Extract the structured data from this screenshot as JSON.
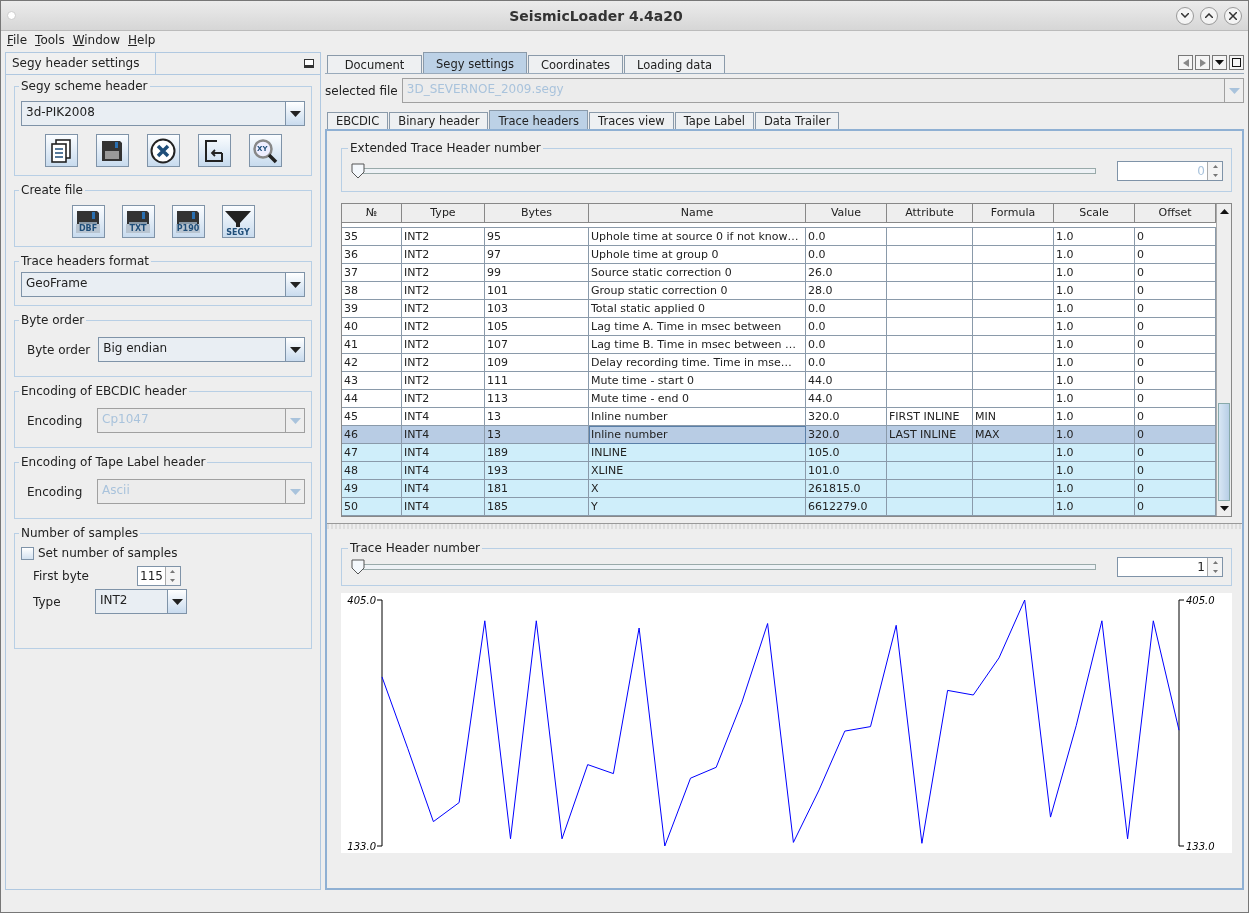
{
  "window": {
    "title": "SeismicLoader 4.4a20"
  },
  "menu": [
    {
      "label": "File"
    },
    {
      "label": "Tools"
    },
    {
      "label": "Window"
    },
    {
      "label": "Help"
    }
  ],
  "left_panel": {
    "title": "Segy header settings",
    "scheme": {
      "legend": "Segy scheme header",
      "value": "3d-PIK2008",
      "buttons": [
        {
          "kind": "copy"
        },
        {
          "kind": "save"
        },
        {
          "kind": "delete"
        },
        {
          "kind": "import"
        },
        {
          "kind": "xy-search",
          "icon_text": "XY"
        }
      ]
    },
    "create_file": {
      "legend": "Create file",
      "buttons": [
        {
          "kind": "floppy",
          "icon_text": "DBF"
        },
        {
          "kind": "floppy",
          "icon_text": "TXT"
        },
        {
          "kind": "floppy",
          "icon_text": "P190"
        },
        {
          "kind": "funnel",
          "icon_text": "SEGY"
        }
      ]
    },
    "trace_format": {
      "legend": "Trace headers format",
      "value": "GeoFrame",
      "disabled": false
    },
    "byte_order": {
      "legend": "Byte order",
      "label": "Byte order",
      "value": "Big endian",
      "disabled": false
    },
    "ebcdic_encoding": {
      "legend": "Encoding of EBCDIC header",
      "label": "Encoding",
      "value": "Cp1047",
      "disabled": true
    },
    "tape_encoding": {
      "legend": "Encoding of Tape Label header",
      "label": "Encoding",
      "value": "Ascii",
      "disabled": true
    },
    "samples": {
      "legend": "Number of samples",
      "checkbox": {
        "label": "Set number of samples",
        "checked": false
      },
      "first_byte": {
        "label": "First byte",
        "value": "115"
      },
      "type": {
        "label": "Type",
        "value": "INT2",
        "disabled": false
      }
    }
  },
  "tabs": [
    {
      "label": "Document",
      "selected": false
    },
    {
      "label": "Segy settings",
      "selected": true
    },
    {
      "label": "Coordinates",
      "selected": false
    },
    {
      "label": "Loading data",
      "selected": false
    }
  ],
  "selected_file": {
    "label": "selected file",
    "value": "3D_SEVERNOE_2009.segy",
    "disabled": true
  },
  "subtabs": [
    {
      "label": "EBCDIC",
      "selected": false
    },
    {
      "label": "Binary header",
      "selected": false
    },
    {
      "label": "Trace headers",
      "selected": true
    },
    {
      "label": "Traces view",
      "selected": false
    },
    {
      "label": "Tape Label",
      "selected": false
    },
    {
      "label": "Data Trailer",
      "selected": false
    }
  ],
  "extended_header": {
    "legend": "Extended Trace Header number",
    "level": 0,
    "value": "0",
    "disabled": true
  },
  "table": {
    "columns": [
      "№",
      "Type",
      "Bytes",
      "Name",
      "Value",
      "Attribute",
      "Formula",
      "Scale",
      "Offset"
    ],
    "rows": [
      {
        "cells": [
          "35",
          "INT2",
          "95",
          "Uphole time at source 0 if not know…",
          "0.0",
          "",
          "",
          "1.0",
          "0"
        ],
        "selected": false,
        "highlighted": false
      },
      {
        "cells": [
          "36",
          "INT2",
          "97",
          "Uphole time at group 0",
          "0.0",
          "",
          "",
          "1.0",
          "0"
        ],
        "selected": false,
        "highlighted": false
      },
      {
        "cells": [
          "37",
          "INT2",
          "99",
          "Source static correction 0",
          "26.0",
          "",
          "",
          "1.0",
          "0"
        ],
        "selected": false,
        "highlighted": false
      },
      {
        "cells": [
          "38",
          "INT2",
          "101",
          "Group static correction 0",
          "28.0",
          "",
          "",
          "1.0",
          "0"
        ],
        "selected": false,
        "highlighted": false
      },
      {
        "cells": [
          "39",
          "INT2",
          "103",
          "Total static applied 0",
          "0.0",
          "",
          "",
          "1.0",
          "0"
        ],
        "selected": false,
        "highlighted": false
      },
      {
        "cells": [
          "40",
          "INT2",
          "105",
          "Lag time A. Time in msec between",
          "0.0",
          "",
          "",
          "1.0",
          "0"
        ],
        "selected": false,
        "highlighted": false
      },
      {
        "cells": [
          "41",
          "INT2",
          "107",
          "Lag time B. Time in msec between …",
          "0.0",
          "",
          "",
          "1.0",
          "0"
        ],
        "selected": false,
        "highlighted": false
      },
      {
        "cells": [
          "42",
          "INT2",
          "109",
          "Delay recording time. Time in mse…",
          "0.0",
          "",
          "",
          "1.0",
          "0"
        ],
        "selected": false,
        "highlighted": false
      },
      {
        "cells": [
          "43",
          "INT2",
          "111",
          "Mute time - start 0",
          "44.0",
          "",
          "",
          "1.0",
          "0"
        ],
        "selected": false,
        "highlighted": false
      },
      {
        "cells": [
          "44",
          "INT2",
          "113",
          "Mute time - end 0",
          "44.0",
          "",
          "",
          "1.0",
          "0"
        ],
        "selected": false,
        "highlighted": false
      },
      {
        "cells": [
          "45",
          "INT4",
          "13",
          "Inline number",
          "320.0",
          "FIRST INLINE",
          "MIN",
          "1.0",
          "0"
        ],
        "selected": false,
        "highlighted": false
      },
      {
        "cells": [
          "46",
          "INT4",
          "13",
          "Inline number",
          "320.0",
          "LAST INLINE",
          "MAX",
          "1.0",
          "0"
        ],
        "selected": true,
        "highlighted": false
      },
      {
        "cells": [
          "47",
          "INT4",
          "189",
          "INLINE",
          "105.0",
          "",
          "",
          "1.0",
          "0"
        ],
        "selected": false,
        "highlighted": true
      },
      {
        "cells": [
          "48",
          "INT4",
          "193",
          "XLINE",
          "101.0",
          "",
          "",
          "1.0",
          "0"
        ],
        "selected": false,
        "highlighted": true
      },
      {
        "cells": [
          "49",
          "INT4",
          "181",
          "X",
          "261815.0",
          "",
          "",
          "1.0",
          "0"
        ],
        "selected": false,
        "highlighted": true
      },
      {
        "cells": [
          "50",
          "INT4",
          "185",
          "Y",
          "6612279.0",
          "",
          "",
          "1.0",
          "0"
        ],
        "selected": false,
        "highlighted": true
      }
    ]
  },
  "trace_header": {
    "legend": "Trace Header number",
    "level": 0,
    "value": "1",
    "chart_data": {
      "type": "line",
      "ylim": [
        133,
        405
      ],
      "yticks": [
        {
          "value": 133,
          "label": "133.0"
        },
        {
          "value": 405,
          "label": "405.0"
        }
      ],
      "categories": [
        null,
        null,
        null,
        null,
        null,
        null,
        null,
        null,
        null,
        null,
        null,
        null,
        null,
        null,
        null,
        null,
        null,
        null,
        null,
        null,
        null,
        null,
        null,
        null,
        null,
        null,
        null,
        null,
        null,
        null,
        null,
        null
      ],
      "series": [
        {
          "color": "#0000ff",
          "values": [
            320,
            241,
            160,
            181,
            382,
            141,
            382,
            141,
            223,
            213,
            374,
            133,
            208,
            220,
            292,
            379,
            137,
            195,
            260,
            265,
            377,
            136,
            305,
            300,
            341,
            405,
            165,
            266,
            382,
            141,
            382,
            261
          ]
        }
      ]
    }
  }
}
